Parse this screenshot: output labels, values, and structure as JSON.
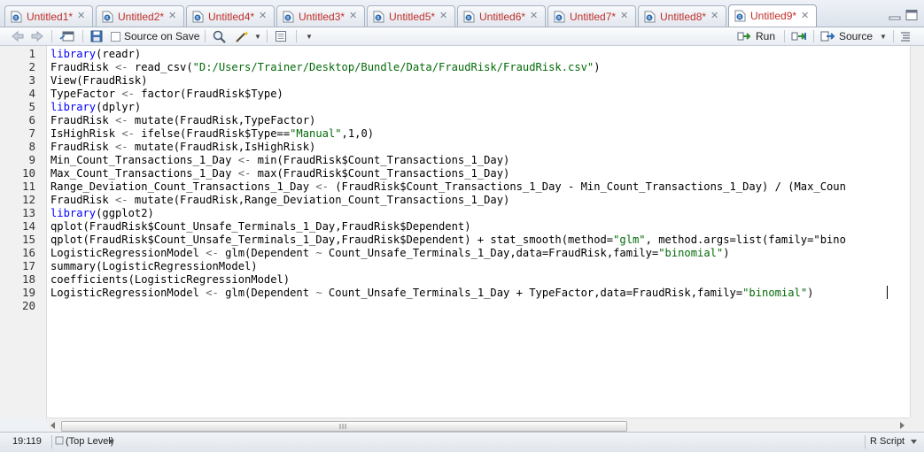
{
  "tabs": [
    {
      "label": "Untitled1*",
      "active": false
    },
    {
      "label": "Untitled2*",
      "active": false
    },
    {
      "label": "Untitled4*",
      "active": false
    },
    {
      "label": "Untitled3*",
      "active": false
    },
    {
      "label": "Untitled5*",
      "active": false
    },
    {
      "label": "Untitled6*",
      "active": false
    },
    {
      "label": "Untitled7*",
      "active": false
    },
    {
      "label": "Untitled8*",
      "active": false
    },
    {
      "label": "Untitled9*",
      "active": true
    }
  ],
  "toolbar": {
    "source_on_save": "Source on Save",
    "run": "Run",
    "source": "Source"
  },
  "editor": {
    "lines": [
      "library(readr)",
      "FraudRisk <- read_csv(\"D:/Users/Trainer/Desktop/Bundle/Data/FraudRisk/FraudRisk.csv\")",
      "View(FraudRisk)",
      "TypeFactor <- factor(FraudRisk$Type)",
      "library(dplyr)",
      "FraudRisk <- mutate(FraudRisk,TypeFactor)",
      "IsHighRisk <- ifelse(FraudRisk$Type==\"Manual\",1,0)",
      "FraudRisk <- mutate(FraudRisk,IsHighRisk)",
      "Min_Count_Transactions_1_Day <- min(FraudRisk$Count_Transactions_1_Day)",
      "Max_Count_Transactions_1_Day <- max(FraudRisk$Count_Transactions_1_Day)",
      "Range_Deviation_Count_Transactions_1_Day <- (FraudRisk$Count_Transactions_1_Day - Min_Count_Transactions_1_Day) / (Max_Coun",
      "FraudRisk <- mutate(FraudRisk,Range_Deviation_Count_Transactions_1_Day)",
      "library(ggplot2)",
      "qplot(FraudRisk$Count_Unsafe_Terminals_1_Day,FraudRisk$Dependent)",
      "qplot(FraudRisk$Count_Unsafe_Terminals_1_Day,FraudRisk$Dependent) + stat_smooth(method=\"glm\", method.args=list(family=\"bino",
      "LogisticRegressionModel <- glm(Dependent ~ Count_Unsafe_Terminals_1_Day,data=FraudRisk,family=\"binomial\")",
      "summary(LogisticRegressionModel)",
      "coefficients(LogisticRegressionModel)",
      "LogisticRegressionModel <- glm(Dependent ~ Count_Unsafe_Terminals_1_Day + TypeFactor,data=FraudRisk,family=\"binomial\")",
      ""
    ]
  },
  "status": {
    "position": "19:119",
    "scope": "(Top Level)",
    "filetype": "R Script"
  },
  "colors": {
    "keyword": "#0000ff",
    "string": "#036a07",
    "tab_text": "#c0302a"
  }
}
